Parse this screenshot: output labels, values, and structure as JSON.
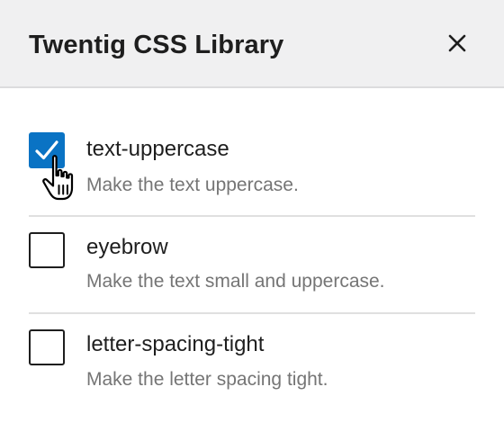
{
  "dialog": {
    "title": "Twentig CSS Library",
    "close_icon": "close-icon"
  },
  "options": [
    {
      "name": "text-uppercase",
      "description": "Make the text uppercase.",
      "checked": true
    },
    {
      "name": "eyebrow",
      "description": "Make the text small and uppercase.",
      "checked": false
    },
    {
      "name": "letter-spacing-tight",
      "description": "Make the letter spacing tight.",
      "checked": false
    }
  ],
  "colors": {
    "checkbox_checked": "#0a73c4",
    "header_bg": "#f0f0f1",
    "description_text": "#757575"
  },
  "cursor_icon": "hand-pointer-icon"
}
